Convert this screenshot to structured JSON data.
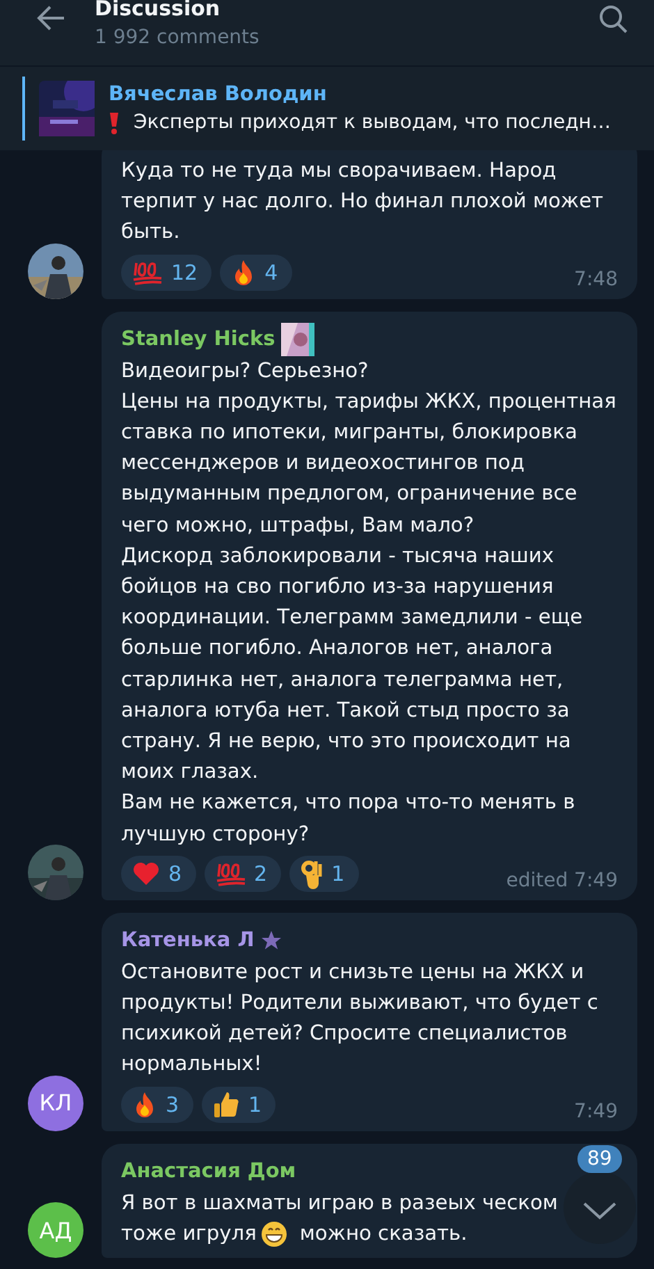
{
  "header": {
    "title": "Discussion",
    "subtitle": "1 992 comments"
  },
  "pinned": {
    "author": "Вячеслав Володин",
    "text": "Эксперты приходят к выводам, что последн…"
  },
  "messages": [
    {
      "avatar": {
        "kind": "picture"
      },
      "text": "Куда то не туда мы сворачиваем. Народ терпит  у нас долго. Но финал плохой может быть.",
      "reactions": [
        {
          "kind": "hundred",
          "count": "12"
        },
        {
          "kind": "fire",
          "count": "4"
        }
      ],
      "time": "7:48"
    },
    {
      "author": "Stanley Hicks",
      "color": "#7bc862",
      "badge": {
        "kind": "picture"
      },
      "avatar": {
        "kind": "picture"
      },
      "text": "Видеоигры? Серьезно?\nЦены на продукты, тарифы ЖКХ, процентная ставка по ипотеки, мигранты, блокировка мессенджеров и видеохостингов под выдуманным предлогом, ограничение все чего можно, штрафы, Вам мало?\nДискорд заблокировали - тысяча наших бойцов на сво погибло из-за нарушения координации. Телеграмм замедлили - еще больше погибло. Аналогов нет, аналога старлинка нет, аналога телеграмма нет, аналога ютуба нет. Такой стыд просто за страну. Я не верю, что это происходит на моих глазах.\nВам не кажется, что пора что-то менять в лучшую сторону?",
      "reactions": [
        {
          "kind": "heart",
          "count": "8"
        },
        {
          "kind": "hundred",
          "count": "2"
        },
        {
          "kind": "ok",
          "count": "1"
        }
      ],
      "time": "edited 7:49"
    },
    {
      "author": "Катенька Л",
      "color": "#a695e7",
      "badge": {
        "kind": "star"
      },
      "avatar": {
        "kind": "initials",
        "initials": "КЛ",
        "color": "#8e6fe0"
      },
      "text": "Остановите рост и снизьте цены на ЖКХ и продукты! Родители выживают, что будет с психикой детей? Спросите специалистов нормальных!",
      "reactions": [
        {
          "kind": "fire",
          "count": "3"
        },
        {
          "kind": "thumbs",
          "count": "1"
        }
      ],
      "time": "7:49"
    },
    {
      "author": "Анастасия Дом",
      "color": "#7bc862",
      "avatar": {
        "kind": "initials",
        "initials": "АД",
        "color": "#5cbf4a"
      },
      "text": "Я вот в шахматы играю в разеых ческом",
      "text2": "тоже игруля",
      "text3": "можно сказать."
    }
  ],
  "scroll_button": {
    "badge": "89"
  }
}
